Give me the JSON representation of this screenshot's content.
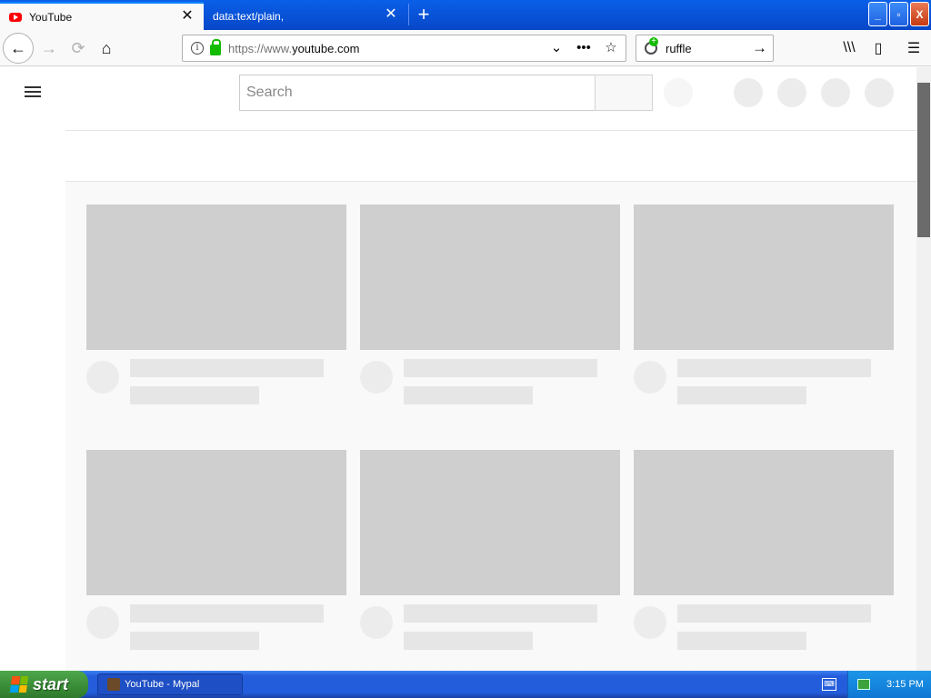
{
  "browser": {
    "tabs": [
      {
        "label": "YouTube",
        "active": true
      },
      {
        "label": "data:text/plain,",
        "active": false
      }
    ],
    "newtab_symbol": "+",
    "tab_close_symbol": "✕",
    "url": {
      "protocol": "https://www.",
      "host": "youtube.com"
    },
    "url_icons": {
      "dropdown": "⌄",
      "more": "•••",
      "bookmark": "☆"
    },
    "search": {
      "value": "ruffle",
      "go": "→"
    },
    "nav": {
      "back": "←",
      "forward": "→",
      "reload": "⟳",
      "home": "⌂"
    },
    "toolbar_right": {
      "library": "\\\\\\",
      "sidebar": "▯",
      "menu": "☰"
    },
    "window_controls": {
      "minimize": "_",
      "restore": "▫",
      "close": "X"
    }
  },
  "youtube": {
    "search_placeholder": "Search"
  },
  "taskbar": {
    "start_label": "start",
    "task_label": "YouTube - Mypal",
    "clock": "3:15 PM"
  },
  "colors": {
    "titlebar": "#0747c8",
    "placeholder": "#cfcfcf",
    "taskbar": "#245ddb",
    "start": "#3c8f3a"
  }
}
